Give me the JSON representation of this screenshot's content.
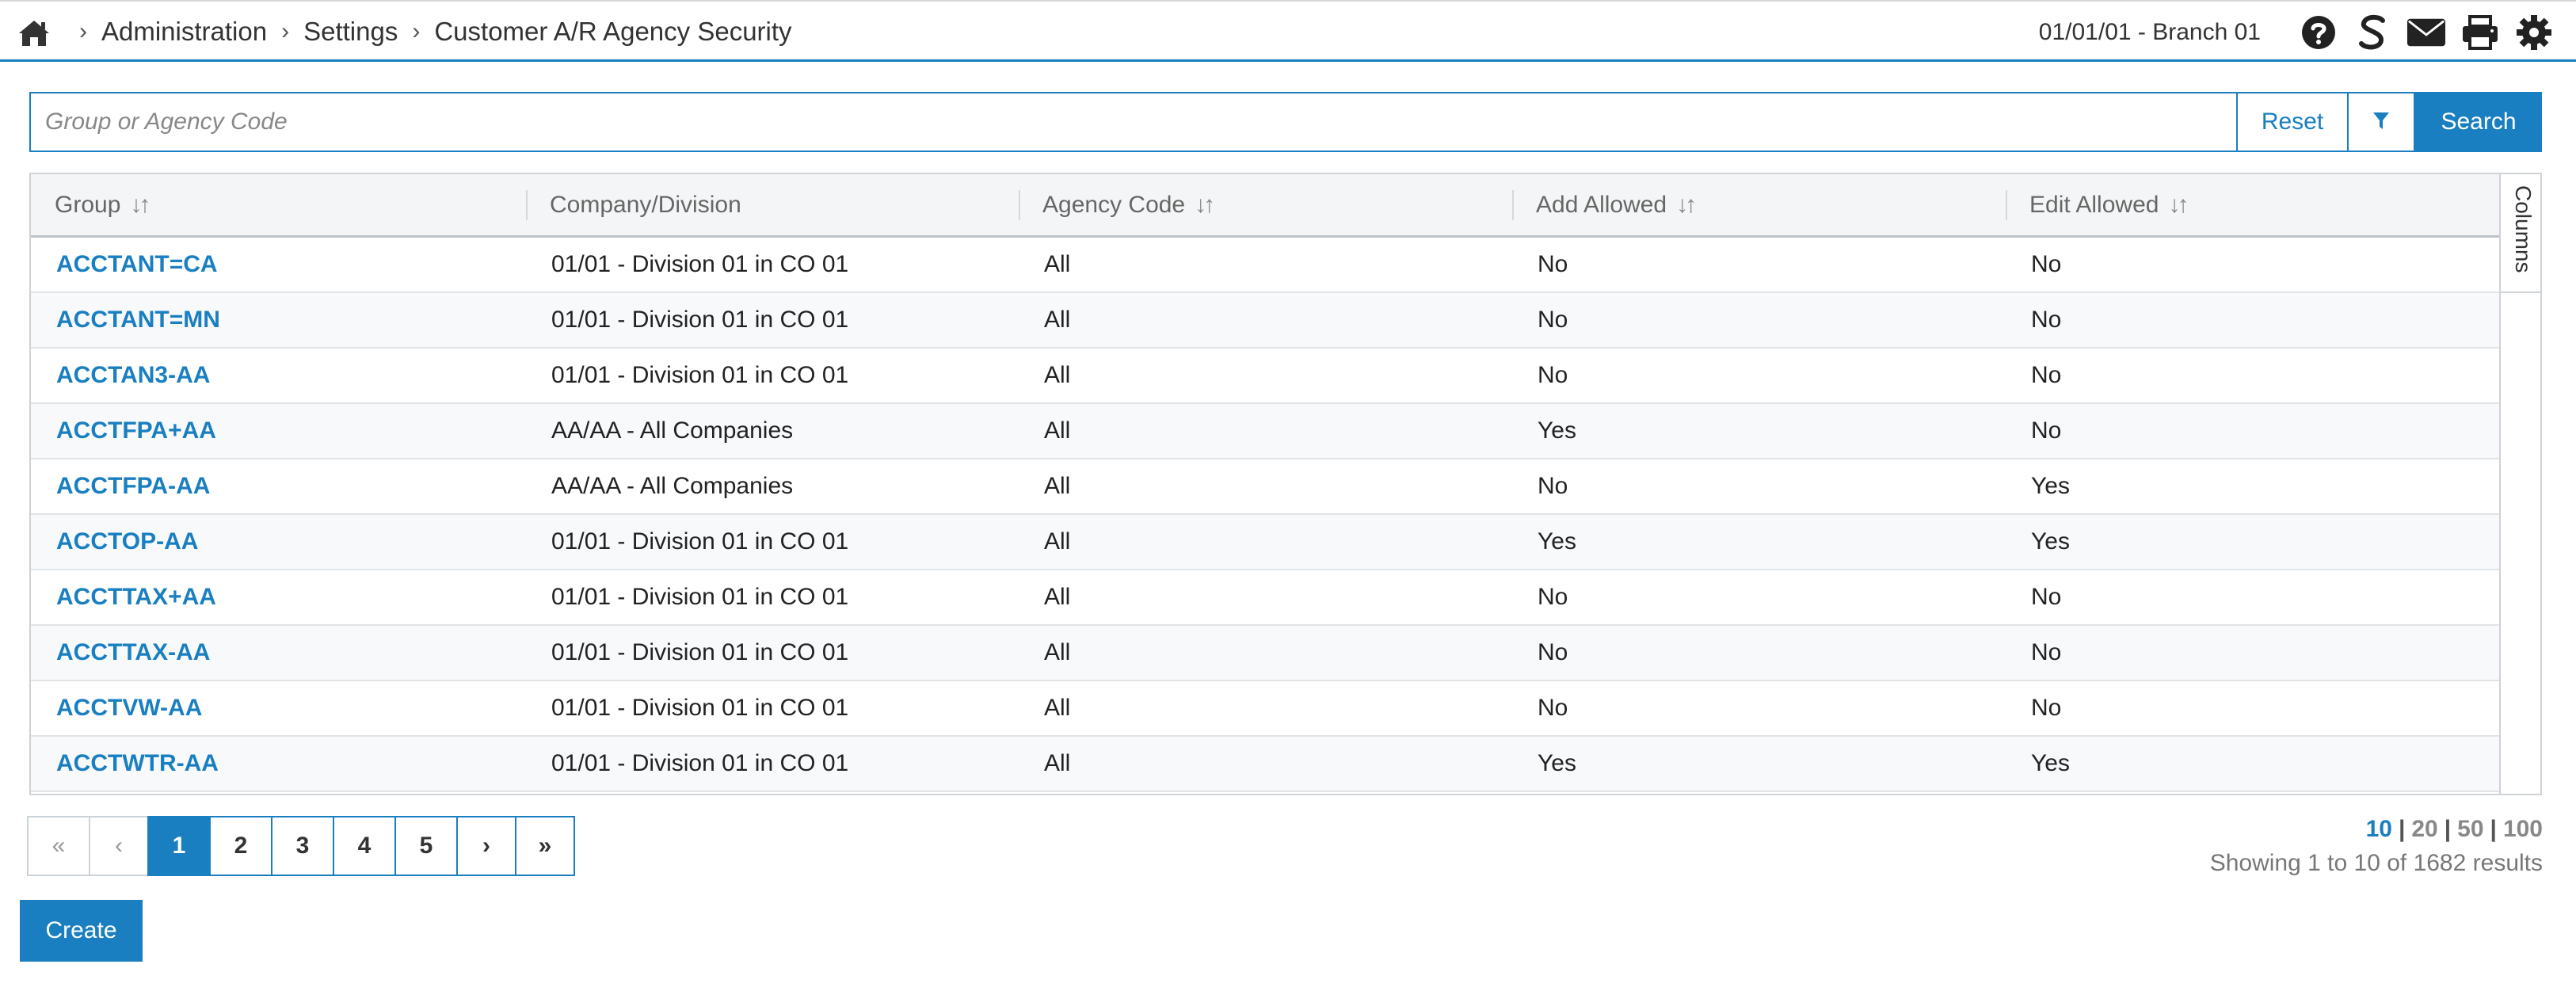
{
  "breadcrumb": {
    "items": [
      "Administration",
      "Settings",
      "Customer A/R Agency Security"
    ]
  },
  "header": {
    "branch": "01/01/01 - Branch 01",
    "icons": [
      "home-icon",
      "help-icon",
      "sage-s-icon",
      "mail-icon",
      "print-icon",
      "gear-icon"
    ]
  },
  "search": {
    "placeholder": "Group or Agency Code",
    "value": "",
    "reset_label": "Reset",
    "search_label": "Search"
  },
  "grid": {
    "columns": [
      "Group",
      "Company/Division",
      "Agency Code",
      "Add Allowed",
      "Edit Allowed"
    ],
    "columns_tab": "Columns",
    "rows": [
      [
        "ACCTANT=CA",
        "01/01 - Division 01 in CO 01",
        "All",
        "No",
        "No"
      ],
      [
        "ACCTANT=MN",
        "01/01 - Division 01 in CO 01",
        "All",
        "No",
        "No"
      ],
      [
        "ACCTAN3-AA",
        "01/01 - Division 01 in CO 01",
        "All",
        "No",
        "No"
      ],
      [
        "ACCTFPA+AA",
        "AA/AA - All Companies",
        "All",
        "Yes",
        "No"
      ],
      [
        "ACCTFPA-AA",
        "AA/AA - All Companies",
        "All",
        "No",
        "Yes"
      ],
      [
        "ACCTOP-AA",
        "01/01 - Division 01 in CO 01",
        "All",
        "Yes",
        "Yes"
      ],
      [
        "ACCTTAX+AA",
        "01/01 - Division 01 in CO 01",
        "All",
        "No",
        "No"
      ],
      [
        "ACCTTAX-AA",
        "01/01 - Division 01 in CO 01",
        "All",
        "No",
        "No"
      ],
      [
        "ACCTVW-AA",
        "01/01 - Division 01 in CO 01",
        "All",
        "No",
        "No"
      ],
      [
        "ACCTWTR-AA",
        "01/01 - Division 01 in CO 01",
        "All",
        "Yes",
        "Yes"
      ]
    ]
  },
  "pagination": {
    "first": "«",
    "prev": "‹",
    "pages": [
      "1",
      "2",
      "3",
      "4",
      "5"
    ],
    "active_page": "1",
    "next": "›",
    "last": "»",
    "page_sizes": [
      "10",
      "20",
      "50",
      "100"
    ],
    "page_size_selected": "10",
    "results_text": "Showing 1 to 10 of 1682 results"
  },
  "actions": {
    "create_label": "Create"
  },
  "colors": {
    "accent": "#1a7fc1",
    "text": "#333333",
    "muted": "#888888"
  }
}
